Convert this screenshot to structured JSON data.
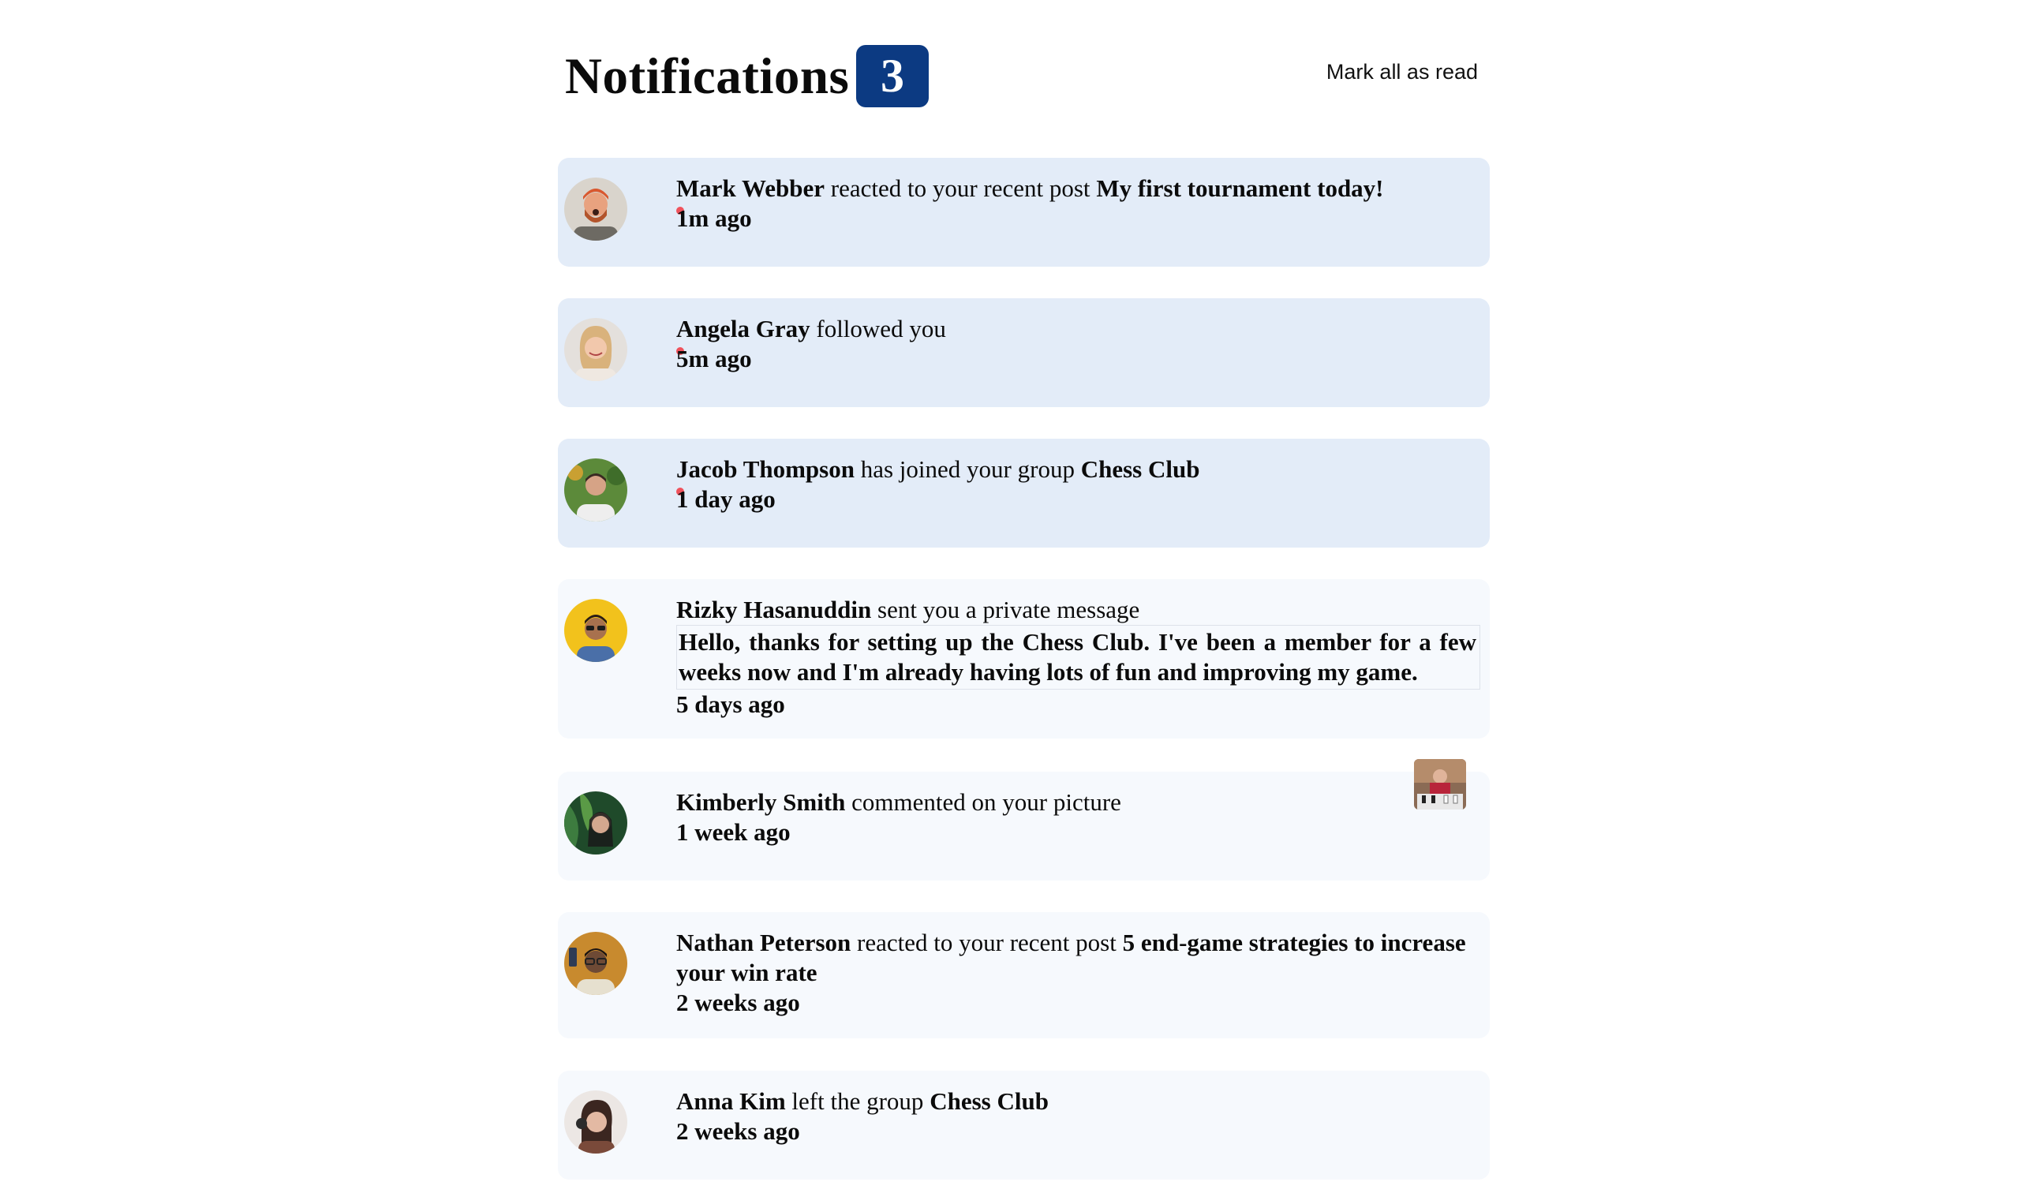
{
  "header": {
    "title": "Notifications",
    "unread_count": "3",
    "mark_all_label": "Mark all as read"
  },
  "notifications": [
    {
      "actor": "Mark Webber",
      "action": "reacted to your recent post",
      "object": "My first tournament today!",
      "time": "1m ago",
      "unread": true,
      "avatar_icon": "avatar-mark-webber"
    },
    {
      "actor": "Angela Gray",
      "action": "followed you",
      "object": "",
      "time": "5m ago",
      "unread": true,
      "avatar_icon": "avatar-angela-gray"
    },
    {
      "actor": "Jacob Thompson",
      "action": "has joined your group",
      "object": "Chess Club",
      "time": "1 day ago",
      "unread": true,
      "avatar_icon": "avatar-jacob-thompson"
    },
    {
      "actor": "Rizky Hasanuddin",
      "action": "sent you a private message",
      "message": "Hello, thanks for setting up the Chess Club. I've been a member for a few weeks now and I'm already having lots of fun and improving my game.",
      "time": "5 days ago",
      "unread": false,
      "avatar_icon": "avatar-rizky-hasanuddin"
    },
    {
      "actor": "Kimberly Smith",
      "action": "commented on your picture",
      "object": "",
      "time": "1 week ago",
      "unread": false,
      "avatar_icon": "avatar-kimberly-smith",
      "thumbnail_icon": "chess-picture-thumbnail"
    },
    {
      "actor": "Nathan Peterson",
      "action": "reacted to your recent post",
      "object": "5 end-game strategies to increase your win rate",
      "time": "2 weeks ago",
      "unread": false,
      "avatar_icon": "avatar-nathan-peterson"
    },
    {
      "actor": "Anna Kim",
      "action": "left the group",
      "object": "Chess Club",
      "time": "2 weeks ago",
      "unread": false,
      "avatar_icon": "avatar-anna-kim"
    }
  ],
  "colors": {
    "badge_bg": "#0c3a82",
    "unread_card_bg": "#e3ecf8",
    "read_card_bg": "#f6f9fd",
    "unread_dot": "#f0525c"
  }
}
